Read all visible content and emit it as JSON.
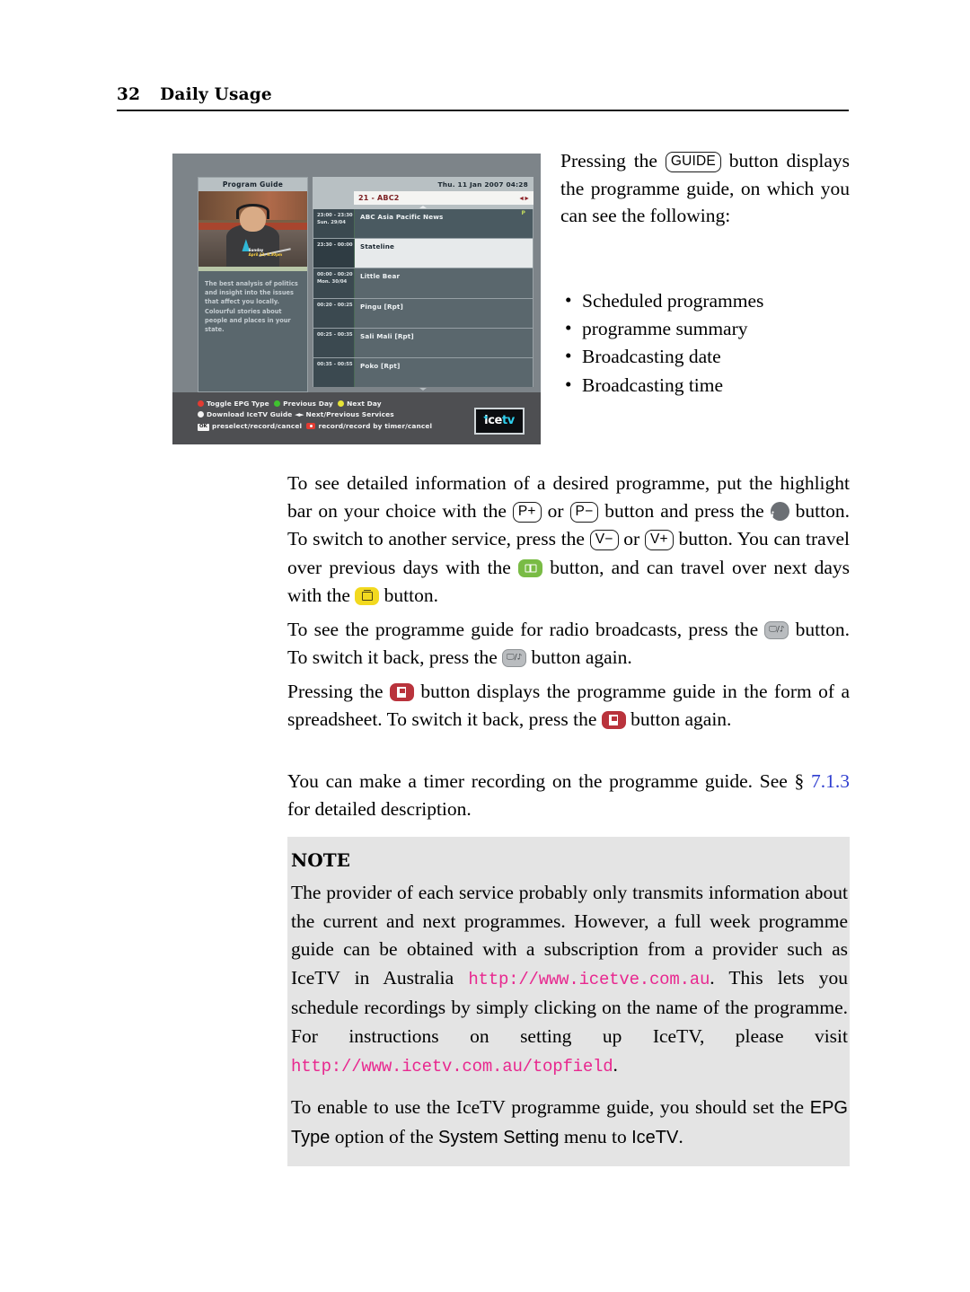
{
  "header": {
    "page_number": "32",
    "section_title": "Daily Usage"
  },
  "epg": {
    "panel_title": "Program Guide",
    "datetime": "Thu. 11 Jan 2007 04:28",
    "service": "21 - ABC2",
    "service_arrows": "◄►",
    "summary": "The best analysis of politics and insight into the issues that affect you locally. Colourful stories about people and places in your state.",
    "thumbnail_caption_line1": "Sunday",
    "thumbnail_caption_line2": "April 12, 8.30pm",
    "rows": [
      {
        "time": "23:00 - 23:30",
        "date": "Sun. 29/04",
        "title": "ABC Asia Pacific News",
        "flag": "P",
        "state": "selected"
      },
      {
        "time": "23:30 - 00:00",
        "date": "",
        "title": "Stateline",
        "flag": "",
        "state": "highlight"
      },
      {
        "time": "00:00 - 00:20",
        "date": "Mon. 30/04",
        "title": "Little Bear",
        "flag": "",
        "state": "normal"
      },
      {
        "time": "00:20 - 00:25",
        "date": "",
        "title": "Pingu [Rpt]",
        "flag": "",
        "state": "normal"
      },
      {
        "time": "00:25 - 00:35",
        "date": "",
        "title": "Sali Mali [Rpt]",
        "flag": "",
        "state": "normal"
      },
      {
        "time": "00:35 - 00:55",
        "date": "",
        "title": "Poko [Rpt]",
        "flag": "",
        "state": "normal"
      }
    ],
    "legend": {
      "toggle_epg_type": "Toggle EPG Type",
      "previous_day": "Previous Day",
      "next_day": "Next Day",
      "download_guide": "Download IceTV Guide",
      "next_previous_services": "Next/Previous Services",
      "ok_key": "OK",
      "preselect": "preselect/record/cancel",
      "record": "record/record by timer/cancel"
    },
    "logo": {
      "part1": "ice",
      "part2": "tv"
    },
    "colors": {
      "red": "#e23b32",
      "green": "#3fc22f",
      "yellow": "#e6e336",
      "white": "#f2f2f2",
      "service_text": "#7b1f22",
      "logo_cyan": "#2fd0ef"
    }
  },
  "intro": {
    "t1": "Pressing the ",
    "key_guide": "GUIDE",
    "t2": " button displays the programme guide, on which you can see the following:"
  },
  "bullets": [
    "Scheduled programmes",
    "programme summary",
    "Broadcasting date",
    "Broadcasting time"
  ],
  "para_detail": {
    "t1": "To see detailed information of a desired programme, put the highlight bar on your choice with the ",
    "key_pplus": "P+",
    "t2": " or ",
    "key_pminus": "P−",
    "t3": " button and press the ",
    "icon_info": "i",
    "t4": " button. To switch to another service, press the ",
    "key_vminus": "V−",
    "t5": " or ",
    "key_vplus": "V+",
    "t6": " button. You can travel over previous days with the ",
    "t7": " button, and can travel over next days with the ",
    "t8": " button."
  },
  "para_radio": {
    "t1": "To see the programme guide for radio broadcasts, press the ",
    "t2": " button. To switch it back, press the ",
    "t3": " button again."
  },
  "para_spread": {
    "t1": "Pressing the ",
    "t2": " button displays the programme guide in the form of a spreadsheet. To switch it back, press the ",
    "t3": " button again."
  },
  "para_timer": {
    "t1": "You can make a timer recording on the programme guide. See § ",
    "link": "7.1.3",
    "t2": " for detailed description.",
    "link_color": "#2f3ed0"
  },
  "note": {
    "title": "NOTE",
    "p1_a": "The provider of each service probably only transmits information about the current and next programmes.  However, a full week programme guide can be obtained with a subscription from a provider such as IceTV in Australia ",
    "p1_url1": "http://www.icetve.com.au",
    "p1_b": ". This lets you schedule recordings by simply clicking on the name of the programme.  For instructions on setting up IceTV, please visit ",
    "p1_url2": "http://www.icetv.com.au/topfield",
    "p1_c": ".",
    "p2_a": "To enable to use the IceTV programme guide, you should set the ",
    "p2_ui1": "EPG Type",
    "p2_b": " option of the ",
    "p2_ui2": "System Setting",
    "p2_c": " menu to ",
    "p2_ui3": "IceTV",
    "p2_d": ".",
    "url_color": "#e8288f",
    "background": "#e4e4e4"
  }
}
